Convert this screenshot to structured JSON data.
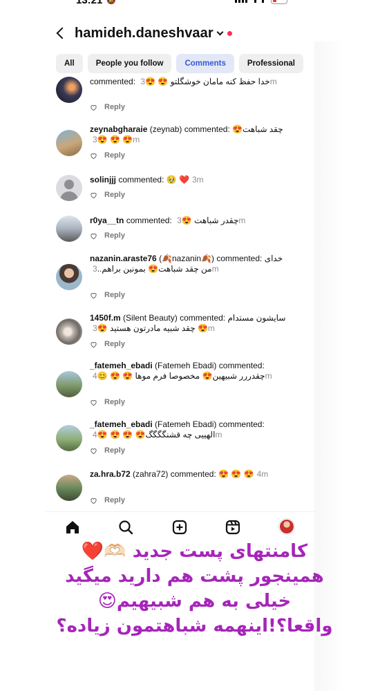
{
  "status": {
    "time": "13:21"
  },
  "header": {
    "username": "hamideh.daneshvaar"
  },
  "filters": [
    {
      "label": "All",
      "active": false
    },
    {
      "label": "People you follow",
      "active": false
    },
    {
      "label": "Comments",
      "active": true
    },
    {
      "label": "Professional",
      "active": false
    }
  ],
  "reply_label": "Reply",
  "comments": [
    {
      "username": "",
      "display_name": "",
      "text": "commented: خدا حفظ کنه مامان خوشگلتو 😍 😍",
      "time": "3m"
    },
    {
      "username": "zeynabgharaie",
      "display_name": "(zeynab)",
      "text": "commented: چقد شباهت😍 😍 😍 😍",
      "time": "3m"
    },
    {
      "username": "solinjjj",
      "display_name": "",
      "text": "commented: 🥹 ❤️",
      "time": "3m"
    },
    {
      "username": "r0ya__tn",
      "display_name": "",
      "text": "commented: چقدر شباهت 😍",
      "time": "3m"
    },
    {
      "username": "nazanin.araste76",
      "display_name": "(🍂nazanin🍂)",
      "text": "commented: خدای من چقد شباهت😍 بمونین براهم..",
      "time": "3m"
    },
    {
      "username": "1450f.m",
      "display_name": "(Silent Beauty)",
      "text": "commented: سایشون مستدام 😍 چقد شبیه مادرتون هستید 😍",
      "time": "3m"
    },
    {
      "username": "_fatemeh_ebadi",
      "display_name": "(Fatemeh Ebadi)",
      "text": "commented: چقدررر شبیهین😍 مخصوصا فرم موها 😍 😍 😊",
      "time": "4m"
    },
    {
      "username": "_fatemeh_ebadi",
      "display_name": "(Fatemeh Ebadi)",
      "text": "commented: الهییی چه قشنگگگگ😍 😍 😍 😍",
      "time": "4m"
    },
    {
      "username": "za.hra.b72",
      "display_name": "(zahra72)",
      "text": "commented: 😍 😍 😍",
      "time": "4m"
    }
  ],
  "caption": [
    "کامنتهای پست جدید 🫶🏻❤️",
    "همینجور پشت هم دارید میگید",
    "خیلی به هم شبیهیم😍",
    "واقعا؟!اینهمه شباهتمون زیاده؟"
  ],
  "colors": {
    "active_chip_text": "#3559d6",
    "active_chip_bg": "#e3e8f6",
    "caption": "#a625b9",
    "notification_dot": "#ff2d55"
  },
  "icons": [
    "back-arrow-icon",
    "chevron-down-icon",
    "heart-icon",
    "home-icon",
    "search-icon",
    "create-icon",
    "reels-icon"
  ]
}
